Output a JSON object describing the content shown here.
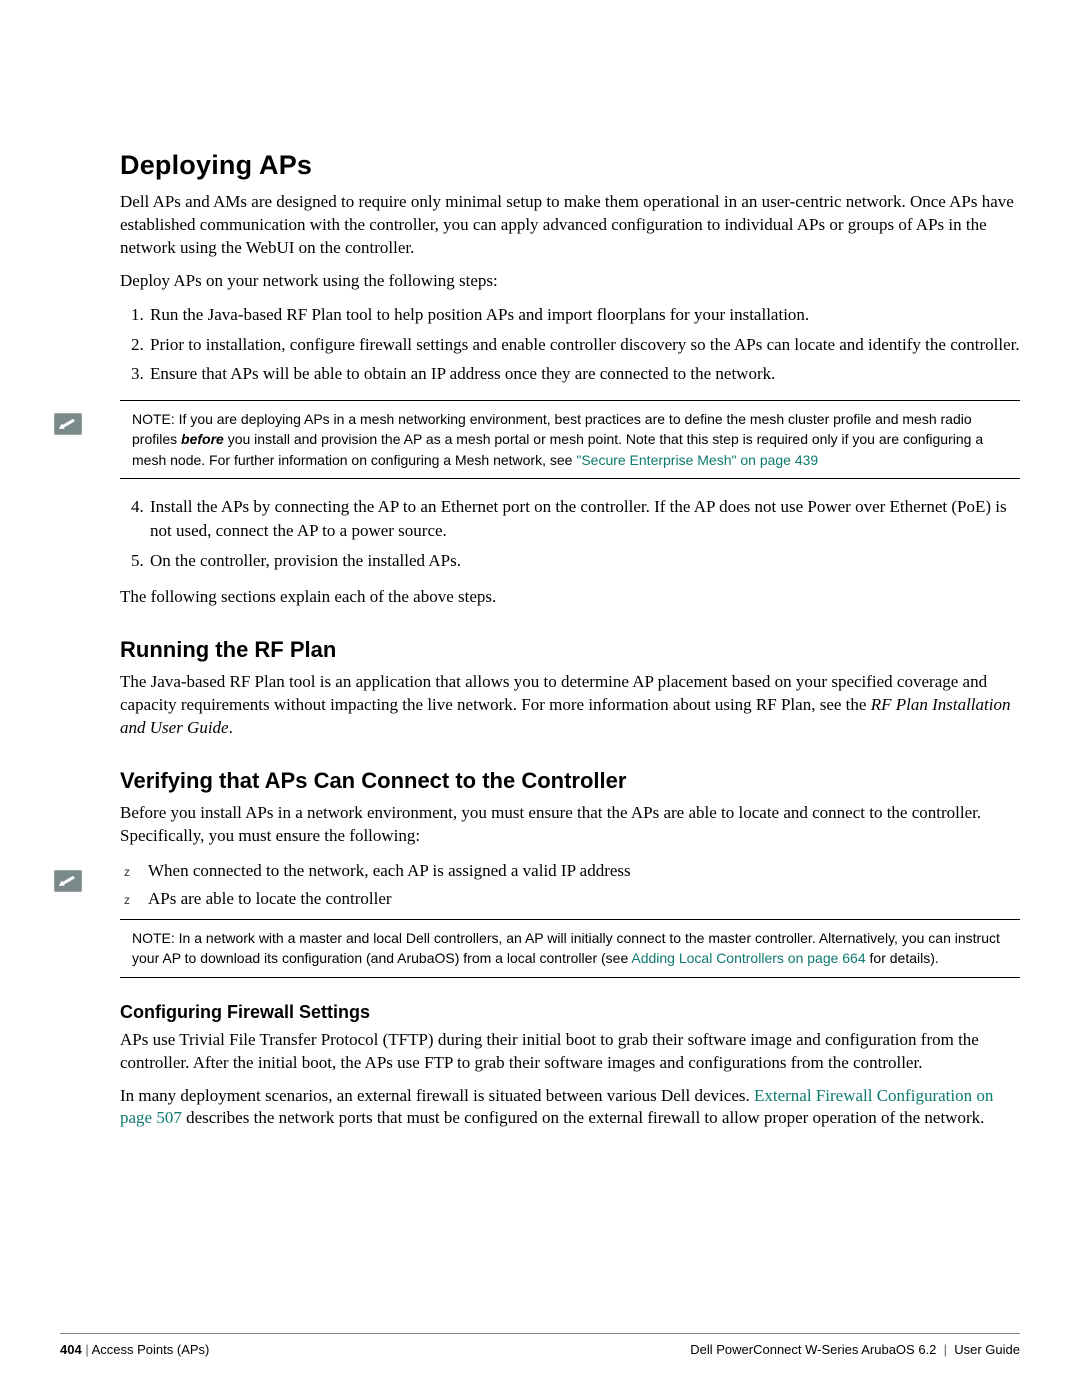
{
  "section": {
    "title": "Deploying APs",
    "intro": "Dell APs and AMs are designed to require only minimal setup to make them operational in an user-centric network. Once APs have established communication with the controller, you can apply advanced configuration to individual APs or groups of APs in the network using the WebUI on the controller.",
    "lead": "Deploy APs on your network using the following steps:",
    "steps_a": [
      "Run the Java-based RF Plan tool to help position APs and import floorplans for your installation.",
      "Prior to installation, configure firewall settings and enable controller discovery so the APs can locate and identify the controller.",
      "Ensure that APs will be able to obtain an IP address once they are connected to the network."
    ],
    "note1": {
      "pre": "NOTE: If you are deploying APs in a mesh networking environment, best practices are to define the mesh cluster profile and mesh radio profiles ",
      "bold": "before",
      "mid": " you install and provision the AP as a mesh portal or mesh point. Note that this step is required only if you are configuring a mesh node. For further information on configuring a Mesh network, see ",
      "link": "\"Secure Enterprise Mesh\" on page 439"
    },
    "steps_b": [
      "Install the APs by connecting the AP to an Ethernet port on the controller. If the AP does not use Power over Ethernet (PoE) is not used, connect the AP to a power source.",
      "On the controller, provision the installed APs."
    ],
    "tail": "The following sections explain each of the above steps."
  },
  "rfplan": {
    "title": "Running the RF Plan",
    "body_a": "The Java-based RF Plan tool is an application that allows you to determine AP placement based on your specified coverage and capacity requirements without impacting the live network. For more information about using RF Plan, see the ",
    "italic": "RF Plan Installation and User Guide",
    "body_b": "."
  },
  "verify": {
    "title": "Verifying that APs Can Connect to the Controller",
    "intro": "Before you install APs in a network environment, you must ensure that the APs are able to locate and connect to the controller. Specifically, you must ensure the following:",
    "bullets": [
      "When connected to the network, each AP is assigned a valid IP address",
      "APs are able to locate the controller"
    ],
    "note2": {
      "pre": "NOTE: In a network with a master and local Dell controllers, an AP will initially connect to the master controller. Alternatively, you can instruct your AP to download its configuration (and ArubaOS) from a local controller (see ",
      "link": "Adding Local Controllers on page 664",
      "post": " for details)."
    }
  },
  "firewall": {
    "title": "Configuring Firewall Settings",
    "p1": "APs use Trivial File Transfer Protocol (TFTP) during their initial boot to grab their software image and configuration from the controller. After the initial boot, the APs use FTP to grab their software images and configurations from the controller.",
    "p2a": "In many deployment scenarios, an external firewall is situated between various Dell devices. ",
    "link": "External Firewall Configuration on page 507",
    "p2b": " describes the network ports that must be configured on the external firewall to allow proper operation of the network."
  },
  "footer": {
    "page": "404",
    "left": "Access Points (APs)",
    "right_a": "Dell PowerConnect W-Series ArubaOS 6.2",
    "right_b": "User Guide"
  }
}
